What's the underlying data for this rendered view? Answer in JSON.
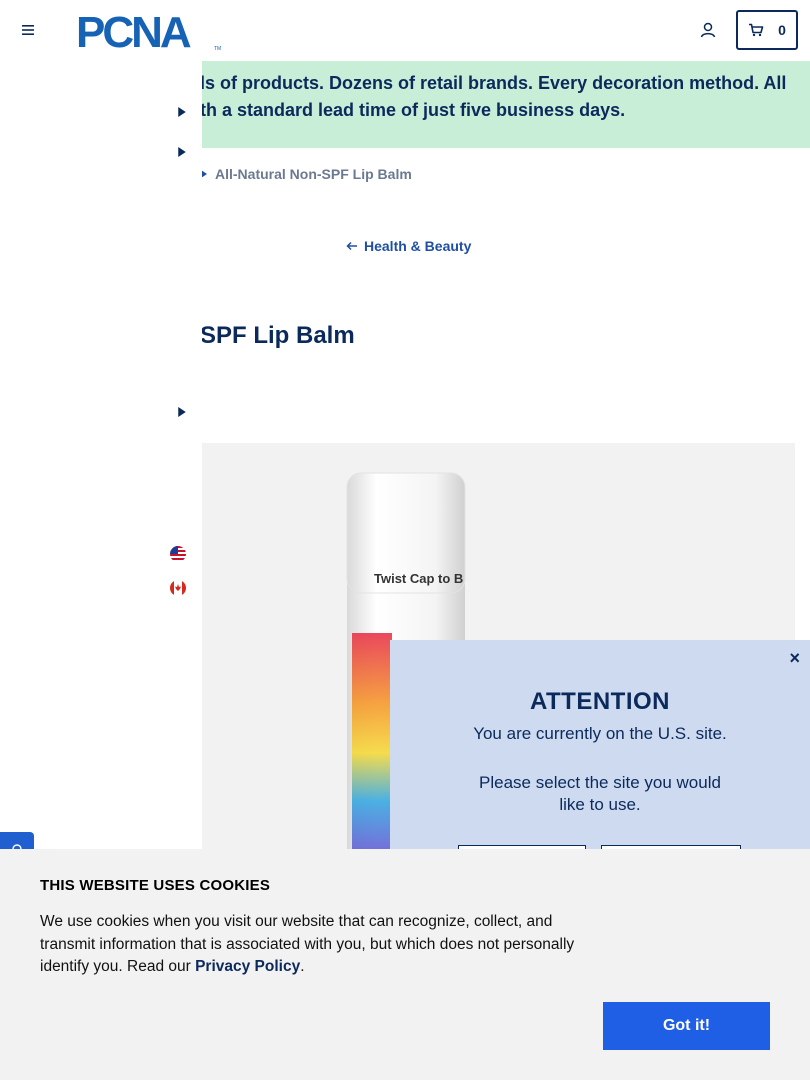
{
  "header": {
    "logo_text": "PCNA",
    "logo_tm": "TM",
    "cart_count": "0"
  },
  "banner": {
    "line1": "ls of products. Dozens of retail brands. Every decoration method. All",
    "line2": "th a standard lead time of just five business days."
  },
  "breadcrumb": {
    "current": "All-Natural Non-SPF Lip Balm"
  },
  "back_link": {
    "label": "Health & Beauty"
  },
  "product": {
    "title": "SPF Lip Balm",
    "cap_text": "Twist Cap to B"
  },
  "modal": {
    "close": "×",
    "title": "ATTENTION",
    "line1": "You are currently on the U.S. site.",
    "line2": "Please select the site you would like to use."
  },
  "cookie": {
    "title": "THIS WEBSITE USES COOKIES",
    "text_before": "We use cookies when you visit our website that can recognize, collect, and transmit information that is associated with you, but which does not personally identify you. Read our ",
    "link_label": "Privacy Policy",
    "text_after": ".",
    "button_label": "Got it!"
  },
  "colors": {
    "navy": "#0b2a5b",
    "brand_blue": "#1f5fe6",
    "banner_green": "#c8eed8",
    "modal_blue": "#cddaf0",
    "cookie_bg": "#f2f2f2"
  },
  "icons": [
    "menu-icon",
    "account-icon",
    "cart-icon",
    "caret-right-icon",
    "arrow-left-icon",
    "us-flag-icon",
    "canada-flag-icon",
    "chat-icon",
    "close-icon"
  ]
}
